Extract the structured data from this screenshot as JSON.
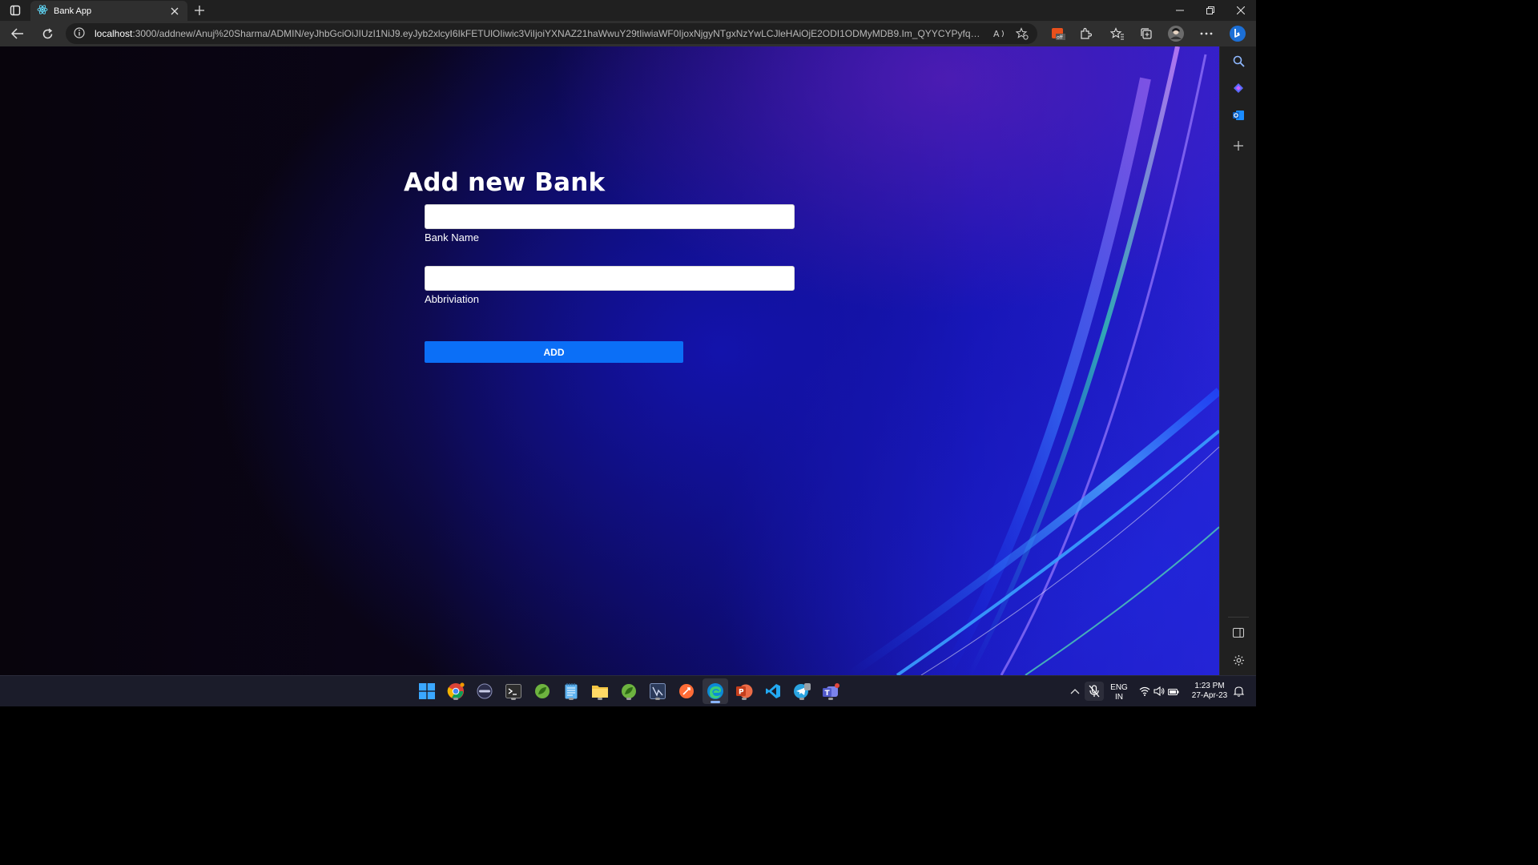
{
  "browser": {
    "tab_title": "Bank App",
    "url_host": "localhost",
    "url_rest": ":3000/addnew/Anuj%20Sharma/ADMIN/eyJhbGciOiJIUzI1NiJ9.eyJyb2xlcyI6IkFETUlOIiwic3ViIjoiYXNAZ21haWwuY29tIiwiaWF0IjoxNjgyNTgxNzYwLCJleHAiOjE2ODI1ODMyMDB9.Im_QYYCYPyfq5SvdNY7kNDugBTG..."
  },
  "page": {
    "title": "Add new Bank",
    "bank_name_label": "Bank Name",
    "bank_name_value": "",
    "abbreviation_label": "Abbriviation",
    "abbreviation_value": "",
    "add_button_label": "ADD"
  },
  "tray": {
    "lang_line1": "ENG",
    "lang_line2": "IN",
    "time": "1:23 PM",
    "date": "27-Apr-23"
  },
  "taskbar_apps": [
    "windows-start",
    "chrome",
    "bar-app",
    "terminal",
    "spring-tools",
    "notepad",
    "file-explorer",
    "spring-tools-2",
    "visual-studio",
    "postman",
    "edge",
    "powerpoint",
    "vscode",
    "telegram",
    "teams"
  ],
  "colors": {
    "accent_button": "#0b6ff7",
    "chrome_dark": "#202020"
  }
}
